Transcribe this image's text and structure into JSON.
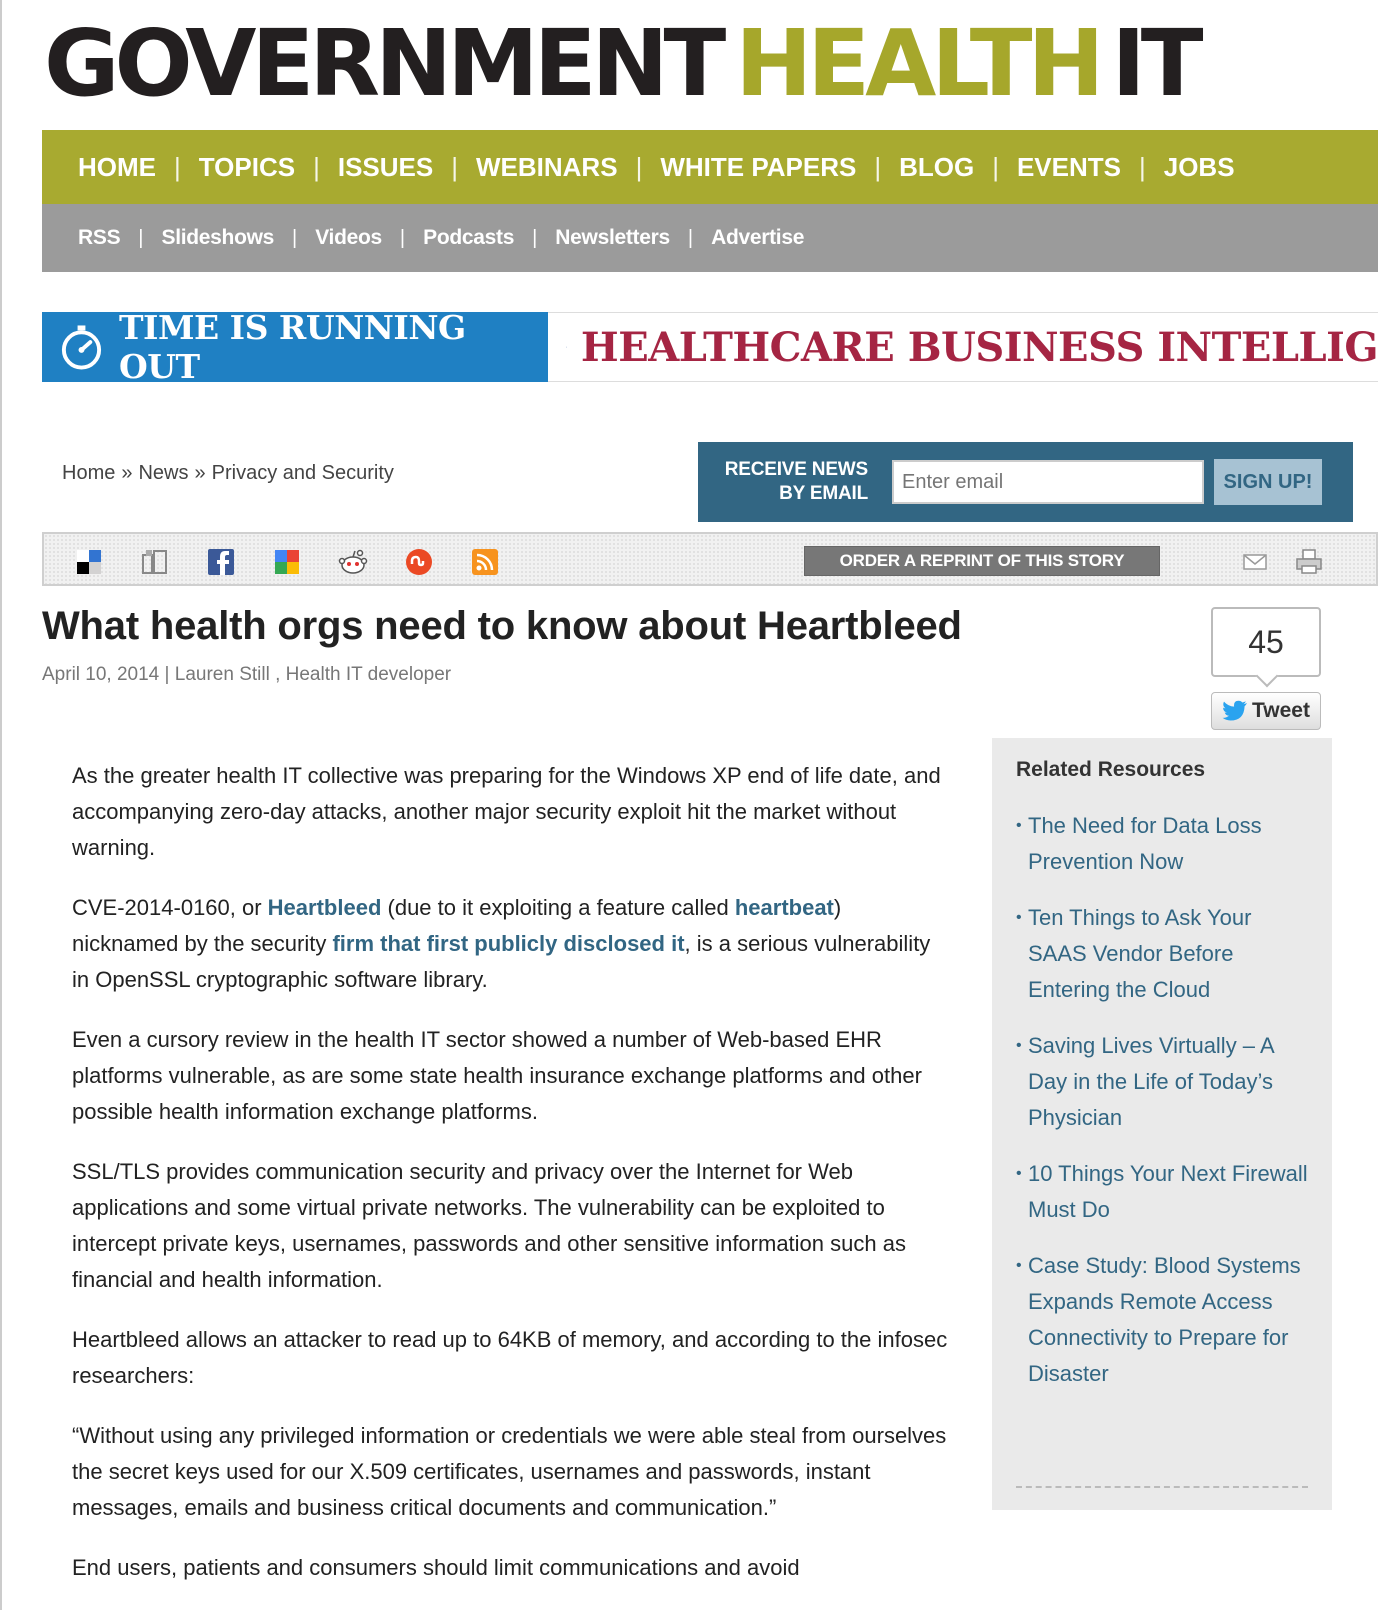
{
  "logo": {
    "part1": "GOVERNMENT",
    "part2": "HEALTH",
    "part3": "IT"
  },
  "nav_primary": [
    "HOME",
    "TOPICS",
    "ISSUES",
    "WEBINARS",
    "WHITE PAPERS",
    "BLOG",
    "EVENTS",
    "JOBS"
  ],
  "nav_secondary": [
    "RSS",
    "Slideshows",
    "Videos",
    "Podcasts",
    "Newsletters",
    "Advertise"
  ],
  "banner": {
    "left_text": "TIME IS RUNNING OUT",
    "right_text": "HEALTHCARE BUSINESS INTELLIG",
    "accent_blue": "#1f80c3",
    "accent_red": "#a52543"
  },
  "breadcrumb": {
    "items": [
      "Home",
      "News",
      "Privacy and Security"
    ],
    "separator": "»"
  },
  "signup": {
    "label_line1": "RECEIVE NEWS",
    "label_line2": "BY EMAIL",
    "placeholder": "Enter email",
    "button": "SIGN UP!"
  },
  "sharebar": {
    "icons": [
      "delicious-icon",
      "digg-icon",
      "facebook-icon",
      "google-icon",
      "reddit-icon",
      "stumbleupon-icon",
      "rss-icon"
    ],
    "reprint_label": "ORDER A REPRINT OF THIS STORY",
    "utility_icons": [
      "email-icon",
      "print-icon"
    ]
  },
  "article": {
    "title": "What health orgs need to know about Heartbleed",
    "date": "April 10, 2014",
    "byline_sep": " | ",
    "author": "Lauren Still",
    "author_role": " , Health IT developer",
    "paragraphs": {
      "p1": "As the greater health IT collective was preparing for the Windows XP end of life date, and accompanying zero-day attacks, another major security exploit hit the market without warning.",
      "p2_a": "CVE-2014-0160, or ",
      "p2_link1": "Heartbleed",
      "p2_b": " (due to it exploiting a feature called ",
      "p2_link2": "heartbeat",
      "p2_c": ") nicknamed by the security ",
      "p2_link3": "firm that first publicly disclosed it",
      "p2_d": ", is a serious vulnerability in OpenSSL cryptographic software library.",
      "p3": "Even a cursory review in the health IT sector showed a number of Web-based EHR platforms vulnerable, as are some state health insurance exchange platforms and other possible health information exchange platforms.",
      "p4": "SSL/TLS provides communication security and privacy over the Internet for Web applications and some virtual private networks. The vulnerability can be exploited to intercept private keys, usernames, passwords and other sensitive information such as financial and health information.",
      "p5": "Heartbleed allows an attacker to read up to 64KB of memory, and according to the infosec researchers:",
      "p6": "“Without using any privileged information or credentials we were able steal from ourselves the secret keys used for our X.509 certificates, usernames and passwords, instant messages, emails and business critical documents and communication.”",
      "p7": "End users, patients and consumers should limit communications and avoid"
    }
  },
  "tweet": {
    "count": "45",
    "label": "Tweet"
  },
  "related": {
    "heading": "Related Resources",
    "items": [
      "The Need for Data Loss Prevention Now",
      "Ten Things to Ask Your SAAS Vendor Before Entering the Cloud",
      "Saving Lives Virtually – A Day in the Life of Today’s Physician",
      "10 Things Your Next Firewall Must Do",
      "Case Study: Blood Systems Expands Remote Access Connectivity to Prepare for Disaster"
    ]
  },
  "colors": {
    "nav_green": "#a8aa30",
    "nav_gray": "#9b9b9b",
    "link_blue": "#326683"
  }
}
